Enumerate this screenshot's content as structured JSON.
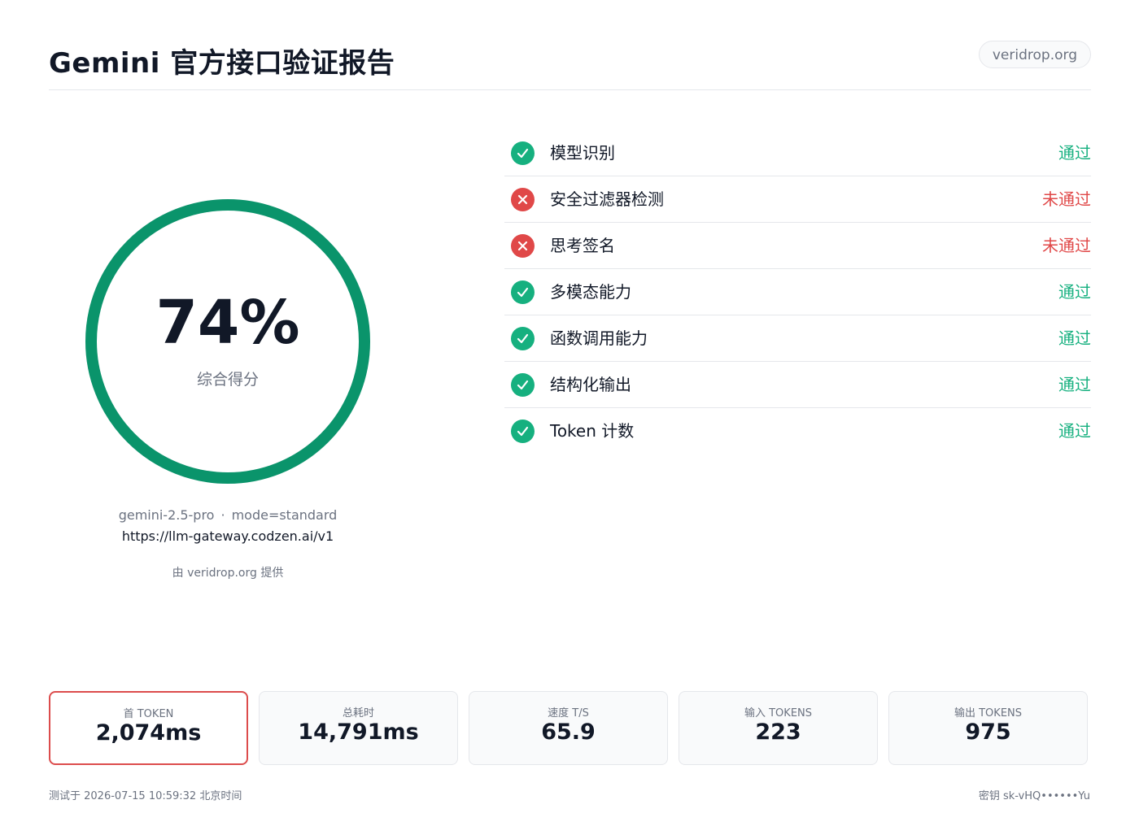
{
  "colors": {
    "pass": "#16b07f",
    "fail": "#e04848",
    "ring": "#0a946b",
    "accent_border": "#dc4c4c"
  },
  "header": {
    "title": "Gemini 官方接口验证报告",
    "domain_badge": "veridrop.org"
  },
  "score": {
    "value": "74%",
    "percent": 74,
    "caption": "综合得分",
    "model": "gemini-2.5-pro",
    "separator": "·",
    "mode": "mode=standard",
    "endpoint": "https://llm-gateway.codzen.ai/v1",
    "powered_by": "由 veridrop.org 提供"
  },
  "checks": [
    {
      "label": "模型识别",
      "result": "通过",
      "status": "pass",
      "icon": "check-icon"
    },
    {
      "label": "安全过滤器检测",
      "result": "未通过",
      "status": "fail",
      "icon": "cross-icon"
    },
    {
      "label": "思考签名",
      "result": "未通过",
      "status": "fail",
      "icon": "cross-icon"
    },
    {
      "label": "多模态能力",
      "result": "通过",
      "status": "pass",
      "icon": "check-icon"
    },
    {
      "label": "函数调用能力",
      "result": "通过",
      "status": "pass",
      "icon": "check-icon"
    },
    {
      "label": "结构化输出",
      "result": "通过",
      "status": "pass",
      "icon": "check-icon"
    },
    {
      "label": "Token 计数",
      "result": "通过",
      "status": "pass",
      "icon": "check-icon"
    }
  ],
  "metrics": [
    {
      "label": "首 TOKEN",
      "value": "2,074ms",
      "highlight": true
    },
    {
      "label": "总耗时",
      "value": "14,791ms",
      "highlight": false
    },
    {
      "label": "速度 T/S",
      "value": "65.9",
      "highlight": false
    },
    {
      "label": "输入 TOKENS",
      "value": "223",
      "highlight": false
    },
    {
      "label": "输出 TOKENS",
      "value": "975",
      "highlight": false
    }
  ],
  "footer": {
    "left": "测试于 2026-07-15 10:59:32 北京时间",
    "right": "密钥 sk-vHQ••••••Yu"
  }
}
